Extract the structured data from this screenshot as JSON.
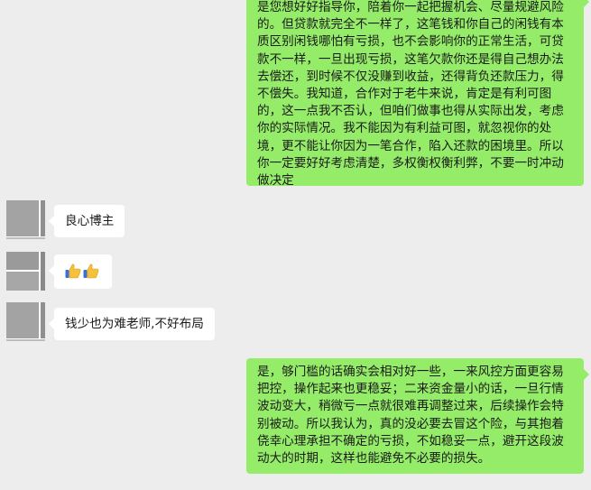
{
  "messages": [
    {
      "id": "m1",
      "direction": "outgoing",
      "text": "是您想好好指导你，陪着你一起把握机会、尽量规避风险的。但贷款就完全不一样了，这笔钱和你自己的闲钱有本质区别闲钱哪怕有亏损，也不会影响你的正常生活，可贷款不一样，一旦出现亏损，这笔欠款你还是得自己想办法去偿还，到时候不仅没赚到收益，还得背负还款压力，得不偿失。我知道，合作对于老牛来说，肯定是有利可图的，这一点我不否认，但咱们做事也得从实际出发，考虑你的实际情况。我不能因为有利益可图，就忽视你的处境，更不能让你因为一笔合作，陷入还款的困境里。所以你一定要好好考虑清楚，多权衡权衡利弊，不要一时冲动做决定"
    },
    {
      "id": "m2",
      "direction": "incoming",
      "text": "良心博主"
    },
    {
      "id": "m3",
      "direction": "incoming",
      "emoji": [
        "thumbs-up",
        "thumbs-up"
      ]
    },
    {
      "id": "m4",
      "direction": "incoming",
      "text": "钱少也为难老师,不好布局"
    },
    {
      "id": "m5",
      "direction": "outgoing",
      "text": "是，够门槛的话确实会相对好一些，一来风控方面更容易把控，操作起来也更稳妥；二来资金量小的话，一旦行情波动变大，稍微亏一点就很难再调整过来，后续操作会特别被动。所以我认为，真的没必要去冒这个险，与其抱着侥幸心理承担不确定的亏损，不如稳妥一点，避开这段波动大的时期，这样也能避免不必要的损失。"
    }
  ],
  "colors": {
    "background": "#ededed",
    "outgoing_bubble": "#95ec69",
    "incoming_bubble": "#ffffff",
    "thumb_yellow": "#f5c13d",
    "thumb_cuff": "#3b6fd1"
  }
}
